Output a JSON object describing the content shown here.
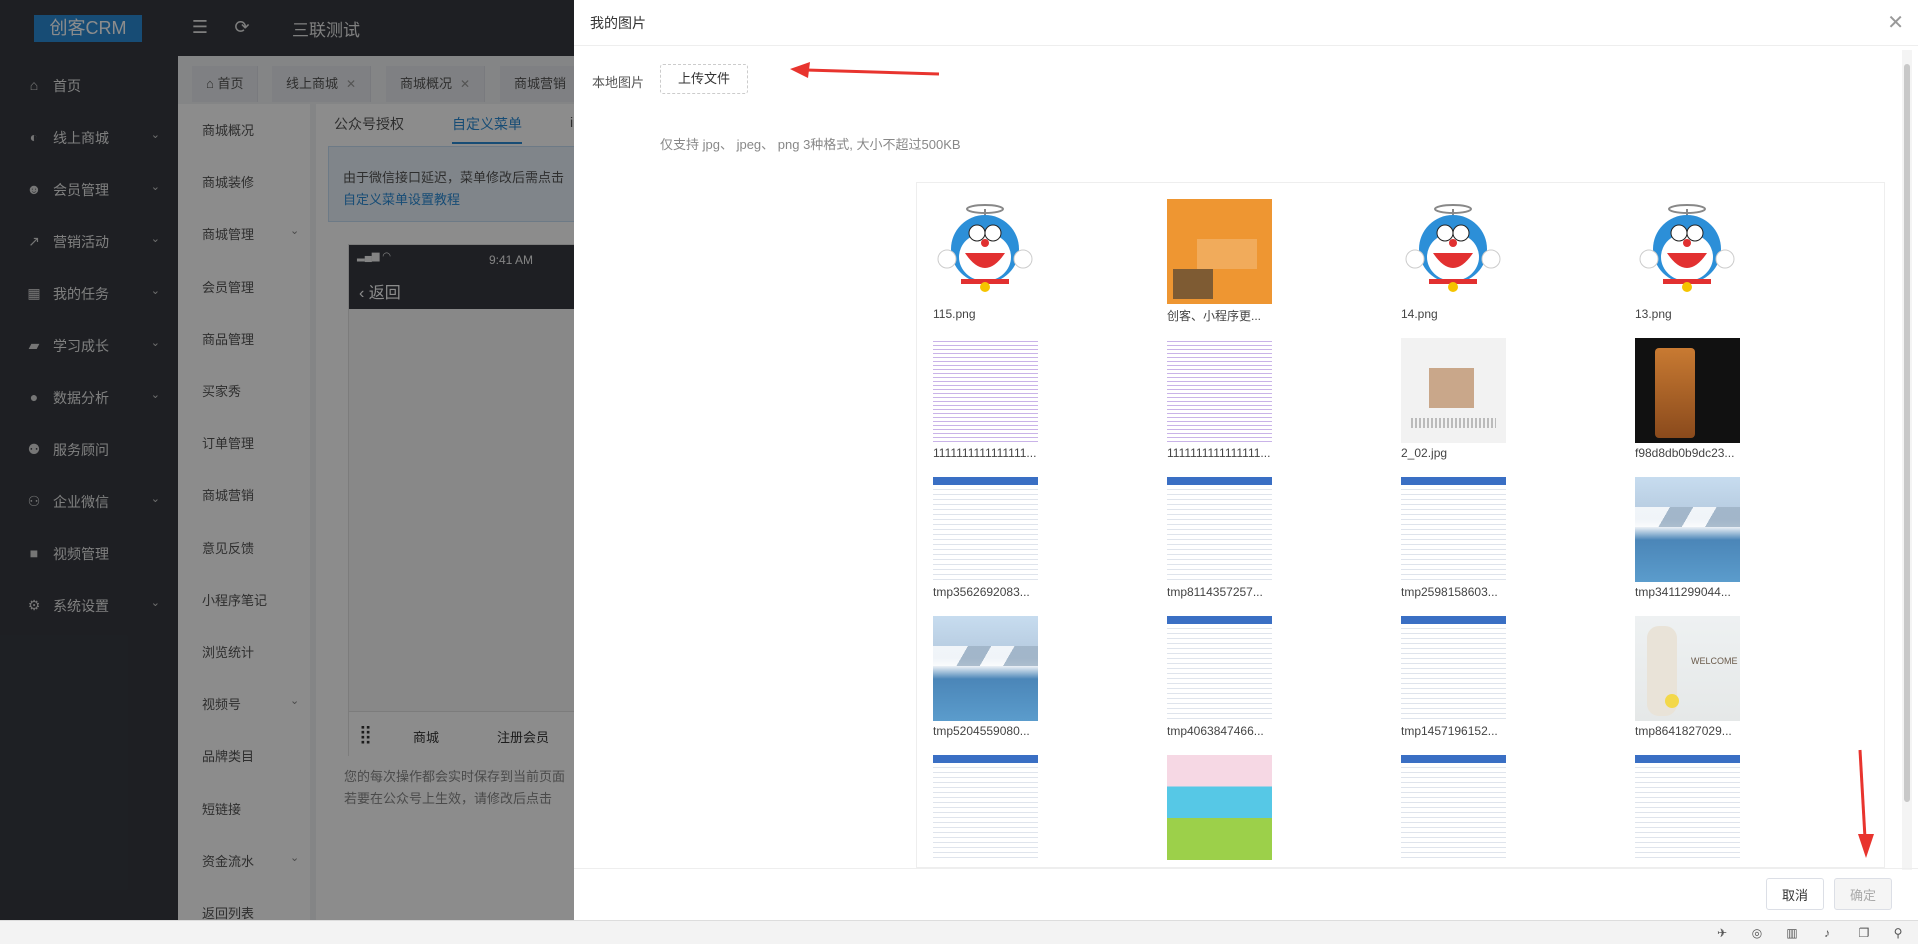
{
  "app": {
    "logo": "创客CRM",
    "title": "三联测试"
  },
  "sidebar": {
    "items": [
      {
        "label": "首页",
        "icon": "home-icon",
        "glyph": "⌂",
        "chev": false
      },
      {
        "label": "线上商城",
        "icon": "shop-icon",
        "glyph": "◐",
        "chev": true
      },
      {
        "label": "会员管理",
        "icon": "user-icon",
        "glyph": "☻",
        "chev": true
      },
      {
        "label": "营销活动",
        "icon": "trend-icon",
        "glyph": "↗",
        "chev": true
      },
      {
        "label": "我的任务",
        "icon": "grid-icon",
        "glyph": "▦",
        "chev": true
      },
      {
        "label": "学习成长",
        "icon": "book-icon",
        "glyph": "▰",
        "chev": true
      },
      {
        "label": "数据分析",
        "icon": "pie-icon",
        "glyph": "●",
        "chev": true
      },
      {
        "label": "服务顾问",
        "icon": "team-icon",
        "glyph": "⚉",
        "chev": false
      },
      {
        "label": "企业微信",
        "icon": "wechat-icon",
        "glyph": "⚇",
        "chev": true
      },
      {
        "label": "视频管理",
        "icon": "video-icon",
        "glyph": "■",
        "chev": false
      },
      {
        "label": "系统设置",
        "icon": "gear-icon",
        "glyph": "⚙",
        "chev": true
      }
    ]
  },
  "tabs": [
    {
      "label": "首页",
      "close": false
    },
    {
      "label": "线上商城",
      "close": true
    },
    {
      "label": "商城概况",
      "close": true
    },
    {
      "label": "商城营销",
      "close": false
    }
  ],
  "subnav": {
    "items": [
      {
        "label": "商城概况",
        "chev": false
      },
      {
        "label": "商城装修",
        "chev": false
      },
      {
        "label": "商城管理",
        "chev": true
      },
      {
        "label": "会员管理",
        "chev": false
      },
      {
        "label": "商品管理",
        "chev": false
      },
      {
        "label": "买家秀",
        "chev": false
      },
      {
        "label": "订单管理",
        "chev": false
      },
      {
        "label": "商城营销",
        "chev": false
      },
      {
        "label": "意见反馈",
        "chev": false
      },
      {
        "label": "小程序笔记",
        "chev": false
      },
      {
        "label": "浏览统计",
        "chev": false
      },
      {
        "label": "视频号",
        "chev": true
      },
      {
        "label": "品牌类目",
        "chev": false
      },
      {
        "label": "短链接",
        "chev": false
      },
      {
        "label": "资金流水",
        "chev": true
      },
      {
        "label": "返回列表",
        "chev": false
      }
    ]
  },
  "content": {
    "tabs": [
      "公众号授权",
      "自定义菜单",
      "i"
    ],
    "notice_text": "由于微信接口延迟，菜单修改后需点击",
    "notice_link": "自定义菜单设置教程",
    "phone": {
      "time": "9:41 AM",
      "back": "返回",
      "menu1": "商城",
      "menu2": "注册会员"
    },
    "hint1": "您的每次操作都会实时保存到当前页面",
    "hint2": "若要在公众号上生效，请修改后点击"
  },
  "modal": {
    "title": "我的图片",
    "local_label": "本地图片",
    "upload_label": "上传文件",
    "format_hint": "仅支持 jpg、 jpeg、 png 3种格式, 大小不超过500KB",
    "cancel_label": "取消",
    "ok_label": "确定",
    "images": [
      {
        "name": "115.png",
        "kind": "doremon"
      },
      {
        "name": "创客、小程序更...",
        "kind": "orange"
      },
      {
        "name": "14.png",
        "kind": "doremon"
      },
      {
        "name": "13.png",
        "kind": "doremon"
      },
      {
        "name": "1111111111111111...",
        "kind": "sheet2"
      },
      {
        "name": "1111111111111111...",
        "kind": "sheet2"
      },
      {
        "name": "2_02.jpg",
        "kind": "girl"
      },
      {
        "name": "f98d8db0b9dc23...",
        "kind": "phoneimg"
      },
      {
        "name": "tmp3562692083...",
        "kind": "sheet"
      },
      {
        "name": "tmp8114357257...",
        "kind": "sheet"
      },
      {
        "name": "tmp2598158603...",
        "kind": "sheet"
      },
      {
        "name": "tmp3411299044...",
        "kind": "lake"
      },
      {
        "name": "tmp5204559080...",
        "kind": "lake"
      },
      {
        "name": "tmp4063847466...",
        "kind": "sheet"
      },
      {
        "name": "tmp1457196152...",
        "kind": "sheet"
      },
      {
        "name": "tmp8641827029...",
        "kind": "welcome"
      },
      {
        "name": "",
        "kind": "sheet"
      },
      {
        "name": "",
        "kind": "boxes"
      },
      {
        "name": "",
        "kind": "sheet"
      },
      {
        "name": "",
        "kind": "sheet"
      }
    ]
  },
  "colors": {
    "sidebar_bg": "#373a41",
    "accent": "#2a8bd6",
    "arrow": "#e8342e"
  }
}
